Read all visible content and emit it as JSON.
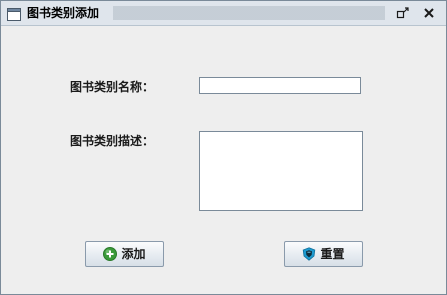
{
  "window": {
    "title": "图书类别添加"
  },
  "form": {
    "name_label": "图书类别名称：",
    "name_value": "",
    "desc_label": "图书类别描述：",
    "desc_value": ""
  },
  "buttons": {
    "add_label": "添加",
    "add_icon": "add-circle-icon",
    "reset_label": "重置",
    "reset_icon": "reset-shield-icon"
  },
  "colors": {
    "titlebar": "#dfe5ec",
    "window_bg": "#eeeeee",
    "border": "#7a8a99",
    "add_icon": "#3a9a3a",
    "reset_icon": "#1d9bd0"
  }
}
